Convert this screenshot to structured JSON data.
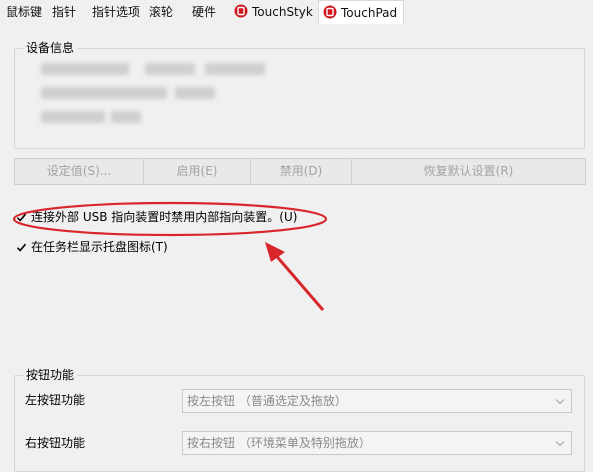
{
  "tabs": [
    {
      "label": "鼠标键"
    },
    {
      "label": "指针"
    },
    {
      "label": "指针选项"
    },
    {
      "label": "滚轮"
    },
    {
      "label": "硬件"
    },
    {
      "label": "TouchStyk",
      "icon": "touch-brand-icon"
    },
    {
      "label": "TouchPad",
      "icon": "touch-brand-icon",
      "selected": true
    }
  ],
  "device_info": {
    "legend": "设备信息"
  },
  "buttons": {
    "settings": "设定值(S)...",
    "enable": "启用(E)",
    "disable": "禁用(D)",
    "restore": "恢复默认设置(R)",
    "state": "disabled"
  },
  "options": {
    "disable_internal": {
      "label": "连接外部 USB 指向装置时禁用内部指向装置。(U)",
      "checked": true
    },
    "tray_icon": {
      "label": "在任务栏显示托盘图标(T)",
      "checked": true
    }
  },
  "button_functions": {
    "legend": "按钮功能",
    "left_label": "左按钮功能",
    "left_value": "按左按钮 （普通选定及拖放）",
    "right_label": "右按钮功能",
    "right_value": "按右按钮 （环境菜单及特别拖放）"
  },
  "colors": {
    "annotation": "#d9262c",
    "brand_icon": "#d0161d"
  },
  "icons": {
    "checkbox": "checkmark-icon",
    "dropdown": "chevron-down-icon"
  }
}
